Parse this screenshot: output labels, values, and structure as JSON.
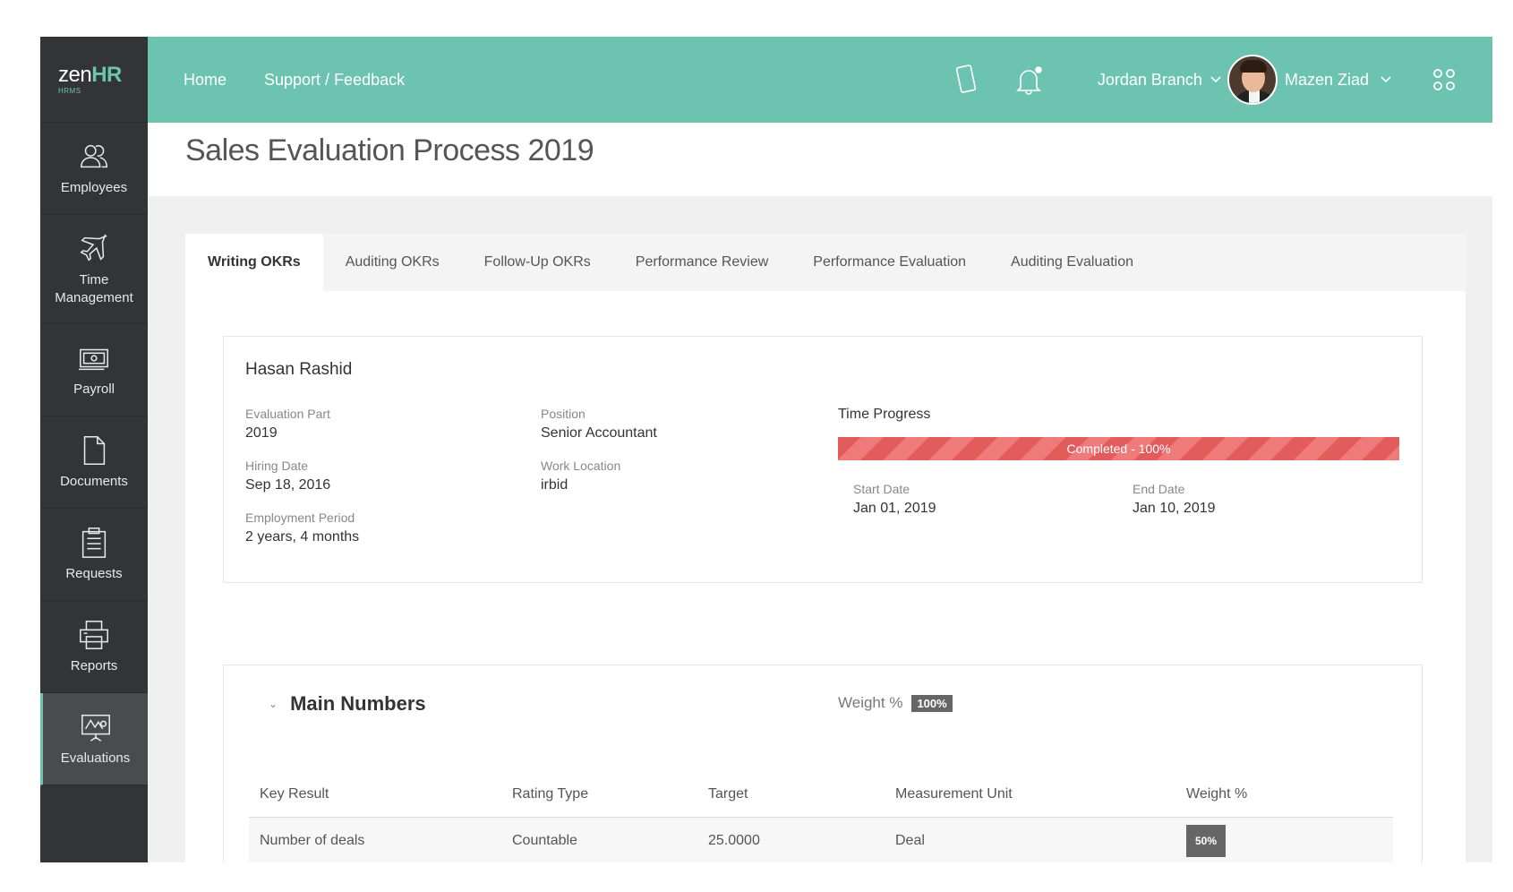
{
  "logo": {
    "brand_prefix": "zen",
    "brand_suffix": "HR",
    "sub": "HRMS"
  },
  "sidebar": {
    "items": [
      {
        "label": "Employees"
      },
      {
        "label": "Time Management"
      },
      {
        "label": "Payroll"
      },
      {
        "label": "Documents"
      },
      {
        "label": "Requests"
      },
      {
        "label": "Reports"
      },
      {
        "label": "Evaluations"
      }
    ]
  },
  "topbar": {
    "nav": [
      "Home",
      "Support / Feedback"
    ],
    "company": "Jordan Branch",
    "user": "Mazen Ziad"
  },
  "page": {
    "title": "Sales Evaluation Process 2019"
  },
  "tabs": [
    "Writing OKRs",
    "Auditing OKRs",
    "Follow-Up OKRs",
    "Performance Review",
    "Performance Evaluation",
    "Auditing Evaluation"
  ],
  "employee": {
    "name": "Hasan Rashid",
    "evaluation_part_label": "Evaluation Part",
    "evaluation_part": "2019",
    "hiring_date_label": "Hiring Date",
    "hiring_date": "Sep 18, 2016",
    "employment_period_label": "Employment Period",
    "employment_period": "2 years, 4 months",
    "position_label": "Position",
    "position": "Senior Accountant",
    "work_location_label": "Work Location",
    "work_location": "irbid"
  },
  "time_progress": {
    "title": "Time Progress",
    "status": "Completed - 100%",
    "percent": 100,
    "start_label": "Start Date",
    "start": "Jan 01, 2019",
    "end_label": "End Date",
    "end": "Jan 10, 2019"
  },
  "section": {
    "title": "Main Numbers",
    "weight_label": "Weight %",
    "weight": "100%",
    "columns": [
      "Key Result",
      "Rating Type",
      "Target",
      "Measurement Unit",
      "Weight %"
    ],
    "rows": [
      {
        "key_result": "Number of deals",
        "rating_type": "Countable",
        "target": "25.0000",
        "unit": "Deal",
        "weight": "50%"
      }
    ]
  }
}
